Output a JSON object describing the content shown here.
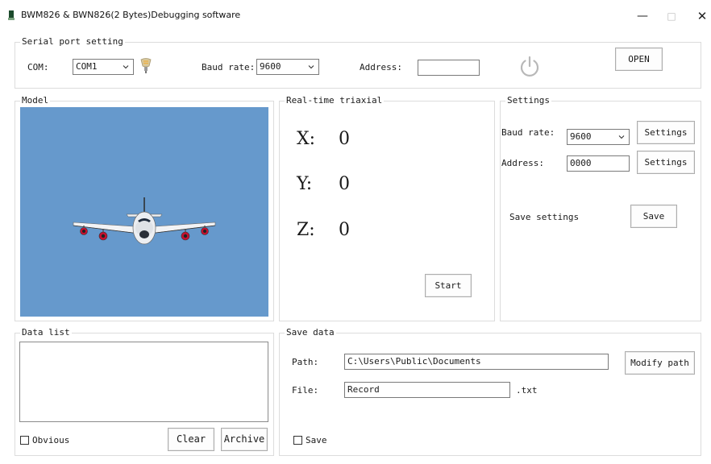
{
  "window": {
    "title": "BWM826 & BWN826(2 Bytes)Debugging software",
    "minimize": "—",
    "maximize": "□",
    "close": "✕"
  },
  "serial": {
    "title": "Serial port setting",
    "com_label": "COM:",
    "com_value": "COM1",
    "baud_label": "Baud rate:",
    "baud_value": "9600",
    "address_label": "Address:",
    "address_value": "",
    "open_button": "OPEN",
    "status_icon": "light-bulb-icon",
    "power_icon": "power-icon"
  },
  "model": {
    "title": "Model",
    "background_color": "#6699CC"
  },
  "realtime": {
    "title": "Real-time triaxial",
    "x_label": "X:",
    "x_value": "0",
    "y_label": "Y:",
    "y_value": "0",
    "z_label": "Z:",
    "z_value": "0",
    "start_button": "Start"
  },
  "settings": {
    "title": "Settings",
    "baud_label": "Baud rate:",
    "baud_value": "9600",
    "baud_button": "Settings",
    "address_label": "Address:",
    "address_value": "0000",
    "address_button": "Settings",
    "save_label": "Save settings",
    "save_button": "Save"
  },
  "datalist": {
    "title": "Data list",
    "obvious_label": "Obvious",
    "obvious_checked": false,
    "clear_button": "Clear",
    "archive_button": "Archive"
  },
  "savedata": {
    "title": "Save data",
    "path_label": "Path:",
    "path_value": "C:\\Users\\Public\\Documents",
    "modify_button": "Modify path",
    "file_label": "File:",
    "file_value": "Record",
    "file_ext": ".txt",
    "save_label": "Save",
    "save_checked": false
  }
}
